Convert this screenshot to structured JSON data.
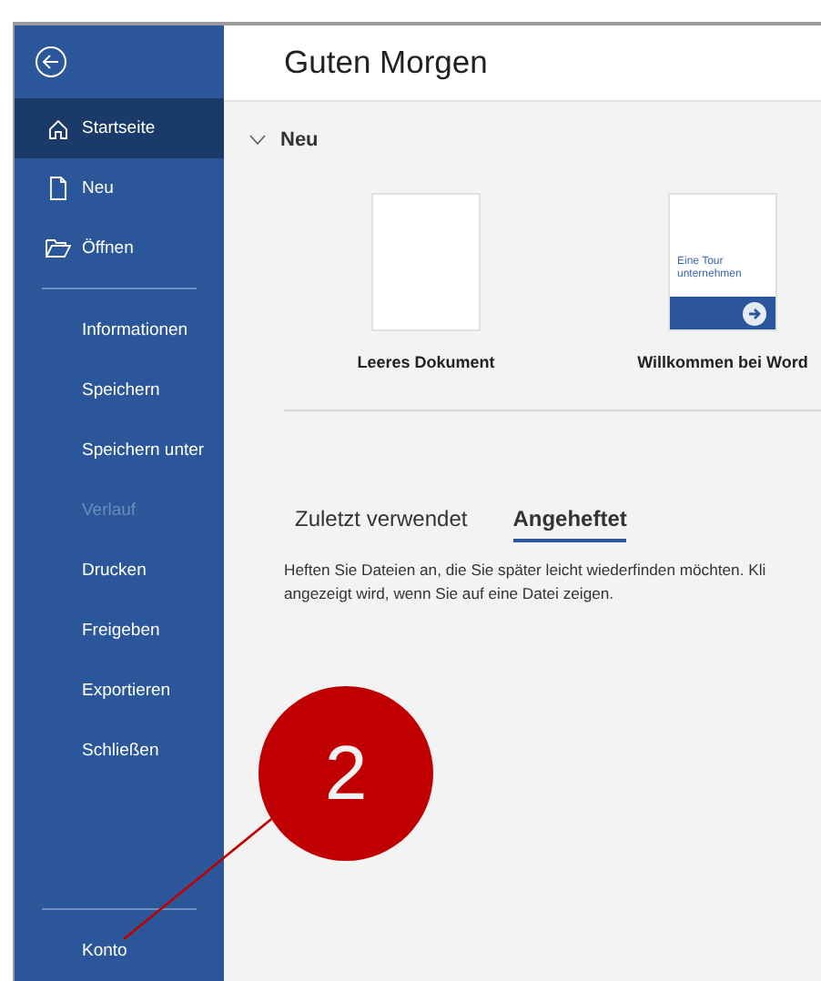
{
  "sidebar": {
    "top_items": [
      {
        "label": "Startseite",
        "selected": true,
        "disabled": false
      },
      {
        "label": "Neu",
        "selected": false,
        "disabled": false
      },
      {
        "label": "Öffnen",
        "selected": false,
        "disabled": false
      }
    ],
    "items": [
      {
        "label": "Informationen",
        "selected": false,
        "disabled": false
      },
      {
        "label": "Speichern",
        "selected": false,
        "disabled": false
      },
      {
        "label": "Speichern unter",
        "selected": false,
        "disabled": false
      },
      {
        "label": "Verlauf",
        "selected": false,
        "disabled": true
      },
      {
        "label": "Drucken",
        "selected": false,
        "disabled": false
      },
      {
        "label": "Freigeben",
        "selected": false,
        "disabled": false
      },
      {
        "label": "Exportieren",
        "selected": false,
        "disabled": false
      },
      {
        "label": "Schließen",
        "selected": false,
        "disabled": false
      }
    ],
    "bottom_items": [
      {
        "label": "Konto",
        "selected": false,
        "disabled": false
      }
    ]
  },
  "main": {
    "title": "Guten Morgen",
    "new_section": {
      "label": "Neu",
      "expanded": true,
      "templates": [
        {
          "kind": "blank",
          "label": "Leeres Dokument"
        },
        {
          "kind": "tour",
          "label": "Willkommen bei Word",
          "thumbnail_text": "Eine Tour unternehmen"
        }
      ]
    },
    "tabs": [
      {
        "label": "Zuletzt verwendet",
        "selected": false
      },
      {
        "label": "Angeheftet",
        "selected": true
      }
    ],
    "description_lines": [
      "Heften Sie Dateien an, die Sie später leicht wiederfinden möchten. Kli",
      "angezeigt wird, wenn Sie auf eine Datei zeigen."
    ]
  },
  "callout": {
    "number": "2"
  }
}
